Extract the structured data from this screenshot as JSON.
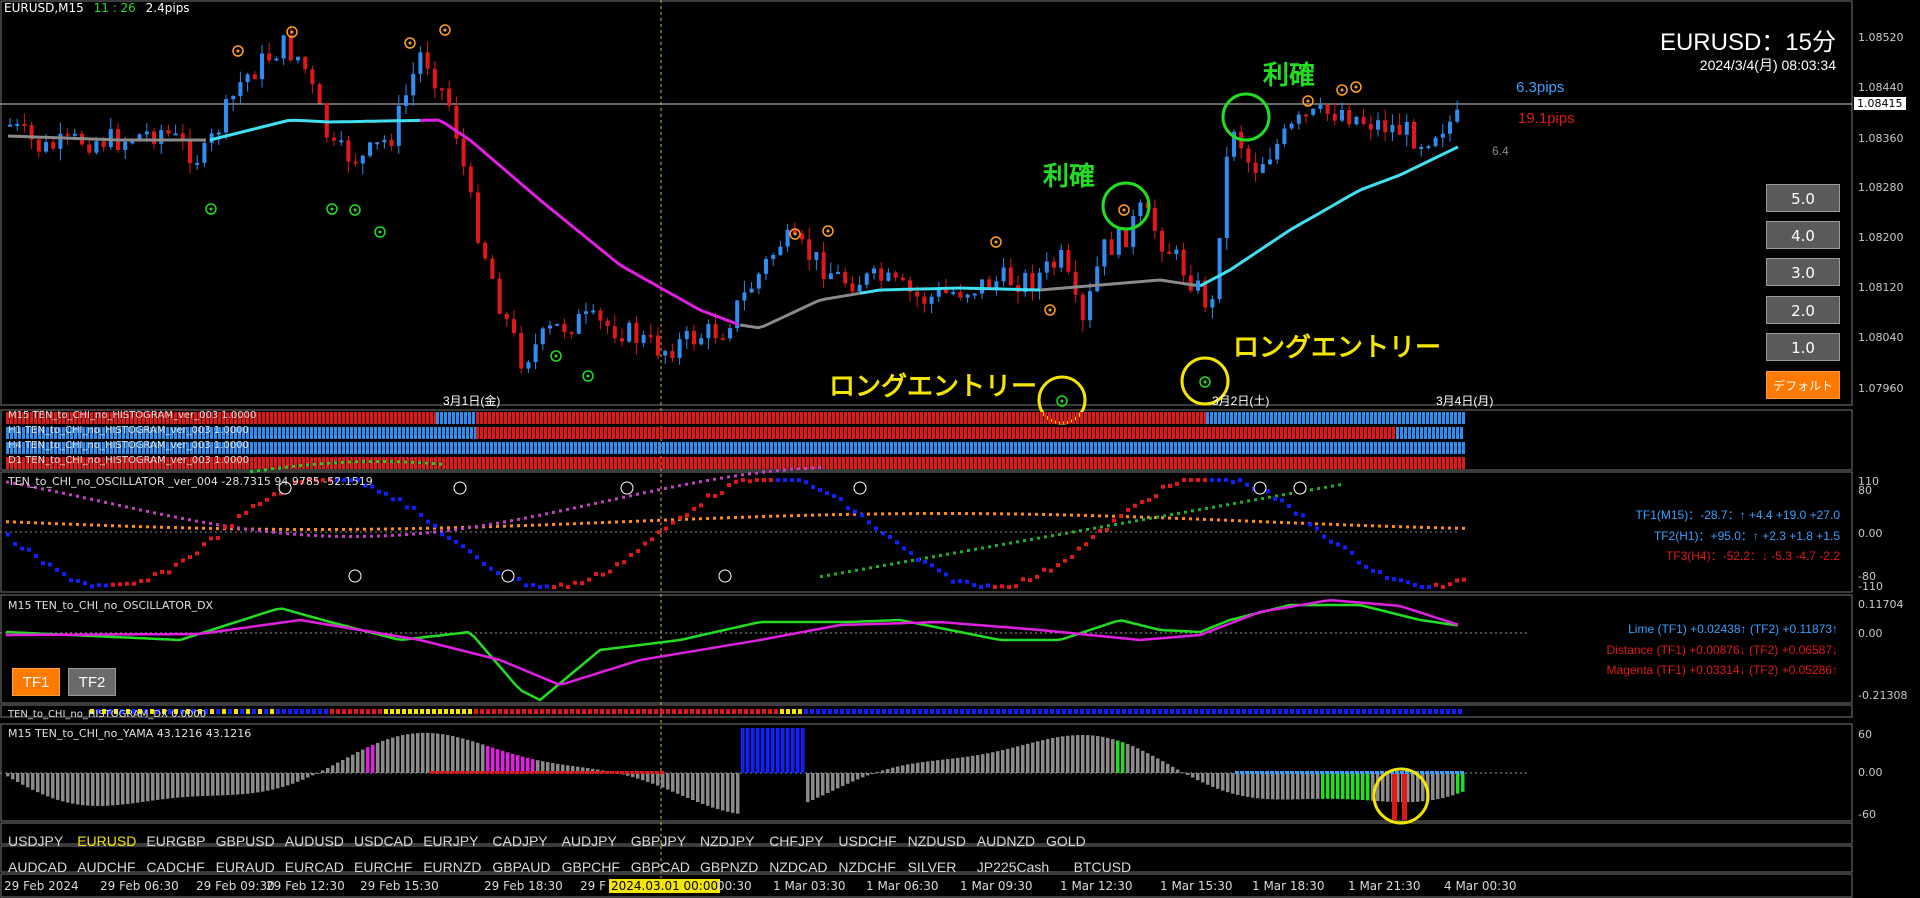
{
  "header": {
    "symbol": "EURUSD,M15",
    "time": "11 : 26",
    "spread": "2.4pips"
  },
  "overlay": {
    "title": "EURUSD：15分",
    "datetime": "2024/3/4(月) 08:03:34"
  },
  "pips": {
    "blue": "6.3pips",
    "red": "19.1pips",
    "gray": "6.4"
  },
  "annotations": {
    "rikaku1": "利確",
    "rikaku2": "利確",
    "long1": "ロングエントリー",
    "long2": "ロングエントリー"
  },
  "date_labels": {
    "d1": "3月1日(金)",
    "d2": "3月2日(土)",
    "d3": "3月4日(月)"
  },
  "price_axis": [
    "1.08520",
    "1.08440",
    "1.08415",
    "1.08360",
    "1.08280",
    "1.08200",
    "1.08120",
    "1.08040",
    "1.07960"
  ],
  "side_buttons": [
    "5.0",
    "4.0",
    "3.0",
    "2.0",
    "1.0",
    "デフォルト"
  ],
  "histogram_rows": [
    "M15 TEN_to_CHI_no_HISTOGRAM_ver_003 1.0000",
    "H1 TEN_to_CHI_no_HISTOGRAM_ver_003 1.0000",
    "H4 TEN_to_CHI_no_HISTOGRAM_ver_003 1.0000",
    "D1 TEN_to_CHI_no_HISTOGRAM_ver_003 1.0000"
  ],
  "oscillator": {
    "title": "TEN_to_CHI_no_OSCILLATOR _ver_004 -28.7315 94.9785 -52.1519",
    "tf1": "TF1(M15)：-28.7：↑ +4.4 +19.0 +27.0",
    "tf2": "TF2(H1)：+95.0：↑ +2.3 +1.8 +1.5",
    "tf3": "TF3(H4)：-52.2：↓ -5.3 -4.7 -2.2",
    "axis": [
      "110",
      "80",
      "0.00",
      "-80",
      "-110"
    ]
  },
  "dx": {
    "title": "M15 TEN_to_CHI_no_OSCILLATOR_DX",
    "lime": "Lime (TF1) +0.02438↑ (TF2) +0.11873↑",
    "distance": "Distance (TF1) +0.00876↓ (TF2) +0.06587↓",
    "magenta": "Magenta (TF1) +0.03314↓ (TF2) +0.05286↑",
    "axis": [
      "0.11704",
      "0.00",
      "-0.21308"
    ],
    "tf1_button": "TF1",
    "tf2_button": "TF2"
  },
  "strip": {
    "title": "TEN_to_CHI_no_HISTOGRAM_DX 0.0000"
  },
  "yama": {
    "title": "M15 TEN_to_CHI_no_YAMA 43.1216 43.1216",
    "axis": [
      "60",
      "0.00",
      "-60"
    ]
  },
  "symbols_row1": [
    "USDJPY",
    "EURUSD",
    "EURGBP",
    "GBPUSD",
    "AUDUSD",
    "USDCAD",
    "EURJPY",
    "CADJPY",
    "AUDJPY",
    "GBPJPY",
    "NZDJPY",
    "CHFJPY",
    "USDCHF",
    "NZDUSD",
    "AUDNZD",
    "GOLD"
  ],
  "symbols_row2": [
    "AUDCAD",
    "AUDCHF",
    "CADCHF",
    "EURAUD",
    "EURCAD",
    "EURCHF",
    "EURNZD",
    "GBPAUD",
    "GBPCHF",
    "GBPCAD",
    "GBPNZD",
    "NZDCAD",
    "NZDCHF",
    "SILVER",
    "JP225Cash",
    "BTCUSD"
  ],
  "active_symbol": "EURUSD",
  "time_axis": [
    "29 Feb 2024",
    "29 Feb 06:30",
    "29 Feb 09:30",
    "29 Feb 12:30",
    "29 Feb 15:30",
    "29 Feb 18:30",
    "29 F",
    "2024.03.01 00:00",
    "00:30",
    "1 Mar 03:30",
    "1 Mar 06:30",
    "1 Mar 09:30",
    "1 Mar 12:30",
    "1 Mar 15:30",
    "1 Mar 18:30",
    "1 Mar 21:30",
    "4 Mar 00:30"
  ],
  "colors": {
    "bull": "#2f8cf0",
    "bear": "#e01818",
    "ma_magenta": "#e020e0",
    "ma_cyan": "#40e0f0",
    "ma_gray": "#8a8a8a",
    "lime": "#22dd22",
    "yellow": "#f4e600"
  }
}
